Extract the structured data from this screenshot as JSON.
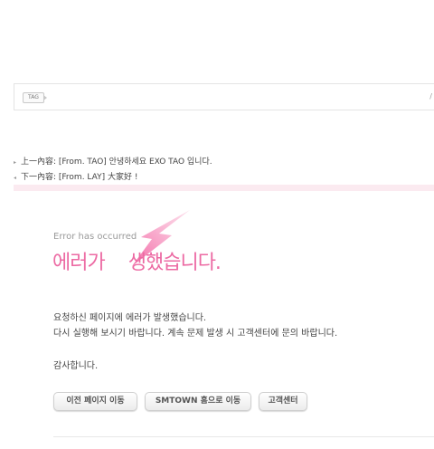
{
  "tag_box": {
    "tag_label": "TAG",
    "right_mark": "/"
  },
  "nav": {
    "prev": {
      "text": "上一內容: [From. TAO] 안녕하세요 EXO TAO 입니다."
    },
    "next": {
      "text": "下一內容: [From. LAY] 大家好 !"
    }
  },
  "error": {
    "small_title": "Error has occurred",
    "headline_left": "에러가",
    "headline_right": "생했습니다.",
    "message_line1": "요청하신 페이지에 에러가 발생했습니다.",
    "message_line2": "다시 실행해 보시기 바랍니다. 계속 문제 발생 시 고객센터에 문의 바랍니다.",
    "thanks": "감사합니다."
  },
  "buttons": {
    "prev_page": "이전 페이지 이동",
    "smtown_home": "SMTOWN 홈으로 이동",
    "customer_center": "고객센터"
  },
  "colors": {
    "accent_pink": "#ec6aa3",
    "pink_bar": "#fbeaf0"
  }
}
